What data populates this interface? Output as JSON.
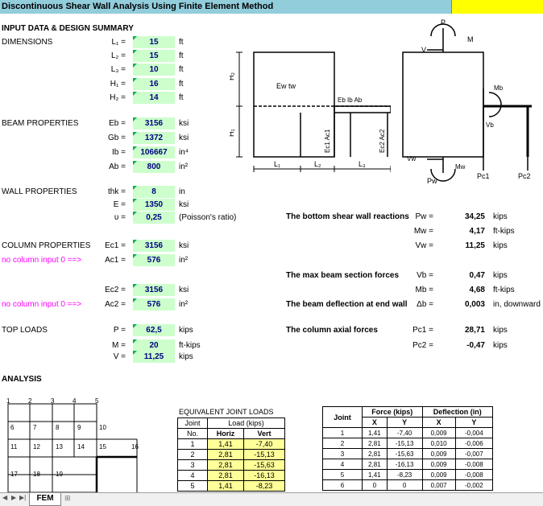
{
  "title": "Discontinuous Shear Wall Analysis Using Finite Element Method",
  "input_header": "INPUT DATA & DESIGN SUMMARY",
  "dimensions": {
    "label": "DIMENSIONS",
    "rows": [
      {
        "sym": "L₁ =",
        "val": "15",
        "unit": "ft"
      },
      {
        "sym": "L₂ =",
        "val": "15",
        "unit": "ft"
      },
      {
        "sym": "L₃ =",
        "val": "10",
        "unit": "ft"
      },
      {
        "sym": "H₁ =",
        "val": "16",
        "unit": "ft"
      },
      {
        "sym": "H₂ =",
        "val": "14",
        "unit": "ft"
      }
    ]
  },
  "beam": {
    "label": "BEAM PROPERTIES",
    "rows": [
      {
        "sym": "Eb =",
        "val": "3156",
        "unit": "ksi"
      },
      {
        "sym": "Gb =",
        "val": "1372",
        "unit": "ksi"
      },
      {
        "sym": "Ib =",
        "val": "106667",
        "unit": "in⁴"
      },
      {
        "sym": "Ab =",
        "val": "800",
        "unit": "in²"
      }
    ]
  },
  "wall": {
    "label": "WALL PROPERTIES",
    "rows": [
      {
        "sym": "thk =",
        "val": "8",
        "unit": "in"
      },
      {
        "sym": "E =",
        "val": "1350",
        "unit": "ksi"
      },
      {
        "sym": "υ =",
        "val": "0,25",
        "unit": "(Poisson's ratio)"
      }
    ]
  },
  "column": {
    "label": "COLUMN PROPERTIES",
    "note": "no column input 0 ==>",
    "rows": [
      {
        "sym": "Ec1 =",
        "val": "3156",
        "unit": "ksi"
      },
      {
        "sym": "Ac1 =",
        "val": "576",
        "unit": "in²"
      },
      {
        "sym": "Ec2 =",
        "val": "3156",
        "unit": "ksi"
      },
      {
        "sym": "Ac2 =",
        "val": "576",
        "unit": "in²"
      }
    ]
  },
  "loads": {
    "label": "TOP LOADS",
    "rows": [
      {
        "sym": "P =",
        "val": "62,5",
        "unit": "kips"
      },
      {
        "sym": "M =",
        "val": "20",
        "unit": "ft-kips"
      },
      {
        "sym": "V =",
        "val": "11,25",
        "unit": "kips"
      }
    ]
  },
  "results": {
    "reactions_label": "The bottom shear wall reactions",
    "beam_forces_label": "The max beam section forces",
    "deflection_label": "The beam deflection at end wall",
    "column_label": "The column axial forces",
    "rows": [
      {
        "sym": "Pw =",
        "val": "34,25",
        "unit": "kips"
      },
      {
        "sym": "Mw =",
        "val": "4,17",
        "unit": "ft-kips"
      },
      {
        "sym": "Vw =",
        "val": "11,25",
        "unit": "kips"
      },
      {
        "sym": "Vb =",
        "val": "0,47",
        "unit": "kips"
      },
      {
        "sym": "Mb =",
        "val": "4,68",
        "unit": "ft-kips"
      },
      {
        "sym": "Δb =",
        "val": "0,003",
        "unit": "in, downward"
      },
      {
        "sym": "Pc1 =",
        "val": "28,71",
        "unit": "kips"
      },
      {
        "sym": "Pc2 =",
        "val": "-0,47",
        "unit": "kips"
      }
    ]
  },
  "diagram_left": {
    "H2": "H₂",
    "H1": "H₁",
    "Ew": "Ew  tw",
    "Eb": "Eb  Ib  Ab",
    "Ec1": "Ec1  Ac1",
    "Ec2": "Ec2  Ac2",
    "L1": "L₁",
    "L2": "L₂",
    "L3": "L₃"
  },
  "diagram_right": {
    "P": "P",
    "M": "M",
    "V": "V",
    "Mb": "Mb",
    "Vb": "Vb",
    "Vw": "Vw",
    "Mw": "Mw",
    "Pw": "Pw",
    "Pc1": "Pc1",
    "Pc2": "Pc2"
  },
  "analysis_header": "ANALYSIS",
  "mesh_numbers": {
    "top": [
      "1",
      "2",
      "3",
      "4",
      "5"
    ],
    "r1": [
      "6",
      "7",
      "8",
      "9",
      "10"
    ],
    "r2": [
      "11",
      "12",
      "13",
      "14",
      "15",
      "16"
    ],
    "r3": [
      "17",
      "18",
      "19"
    ]
  },
  "joint_loads": {
    "caption": "EQUIVALENT JOINT LOADS",
    "h_joint": "Joint",
    "h_no": "No.",
    "h_load": "Load (kips)",
    "h_horiz": "Horiz",
    "h_vert": "Vert",
    "rows": [
      [
        "1",
        "1,41",
        "-7,40"
      ],
      [
        "2",
        "2,81",
        "-15,13"
      ],
      [
        "3",
        "2,81",
        "-15,63"
      ],
      [
        "4",
        "2,81",
        "-16,13"
      ],
      [
        "5",
        "1,41",
        "-8,23"
      ]
    ]
  },
  "fd_table": {
    "h_joint": "Joint",
    "h_force": "Force (kips)",
    "h_defl": "Deflection (in)",
    "h_x": "X",
    "h_y": "Y",
    "rows": [
      [
        "1",
        "1,41",
        "-7,40",
        "0,009",
        "-0,004"
      ],
      [
        "2",
        "2,81",
        "-15,13",
        "0,010",
        "-0,006"
      ],
      [
        "3",
        "2,81",
        "-15,63",
        "0,009",
        "-0,007"
      ],
      [
        "4",
        "2,81",
        "-16,13",
        "0,009",
        "-0,008"
      ],
      [
        "5",
        "1,41",
        "-8,23",
        "0,009",
        "-0,008"
      ],
      [
        "6",
        "0",
        "0",
        "0,007",
        "-0,002"
      ]
    ]
  },
  "sheet_tab": "FEM"
}
